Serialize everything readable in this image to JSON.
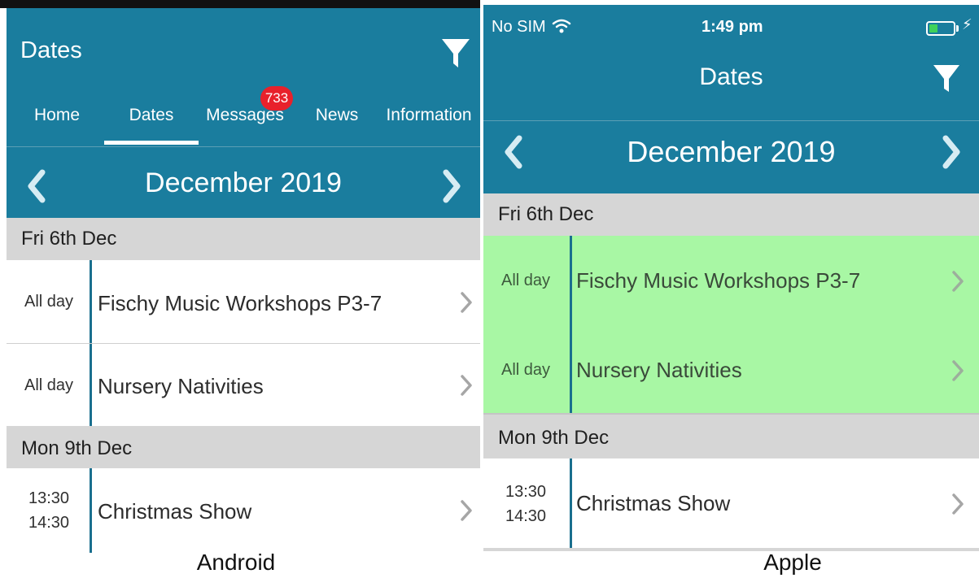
{
  "android": {
    "header_title": "Dates",
    "tabs": [
      {
        "label": "Home"
      },
      {
        "label": "Dates"
      },
      {
        "label": "Messages"
      },
      {
        "label": "News"
      },
      {
        "label": "Information"
      }
    ],
    "messages_badge": "733",
    "month": "December 2019",
    "days": [
      {
        "label": "Fri 6th Dec",
        "events": [
          {
            "time": "All day",
            "title": "Fischy Music Workshops P3-7"
          },
          {
            "time": "All day",
            "title": "Nursery Nativities"
          }
        ]
      },
      {
        "label": "Mon 9th Dec",
        "events": [
          {
            "time_start": "13:30",
            "time_end": "14:30",
            "title": "Christmas Show"
          }
        ]
      }
    ],
    "caption": "Android"
  },
  "apple": {
    "status": {
      "carrier": "No SIM",
      "time": "1:49 pm"
    },
    "header_title": "Dates",
    "month": "December 2019",
    "days": [
      {
        "label": "Fri 6th Dec",
        "events": [
          {
            "time": "All day",
            "title": "Fischy Music Workshops P3-7"
          },
          {
            "time": "All day",
            "title": "Nursery Nativities"
          }
        ]
      },
      {
        "label": "Mon 9th Dec",
        "events": [
          {
            "time_start": "13:30",
            "time_end": "14:30",
            "title": "Christmas Show"
          }
        ]
      }
    ],
    "caption": "Apple"
  },
  "colors": {
    "header": "#1a7d9e",
    "highlight": "#a8f7a4",
    "day_header": "#d6d6d6",
    "badge": "#e8212b"
  },
  "icons": {
    "filter": "filter-icon",
    "prev": "chevron-left-icon",
    "next": "chevron-right-icon",
    "row": "chevron-right-icon",
    "wifi": "wifi-icon",
    "battery": "battery-icon",
    "bolt": "charging-bolt-icon"
  }
}
